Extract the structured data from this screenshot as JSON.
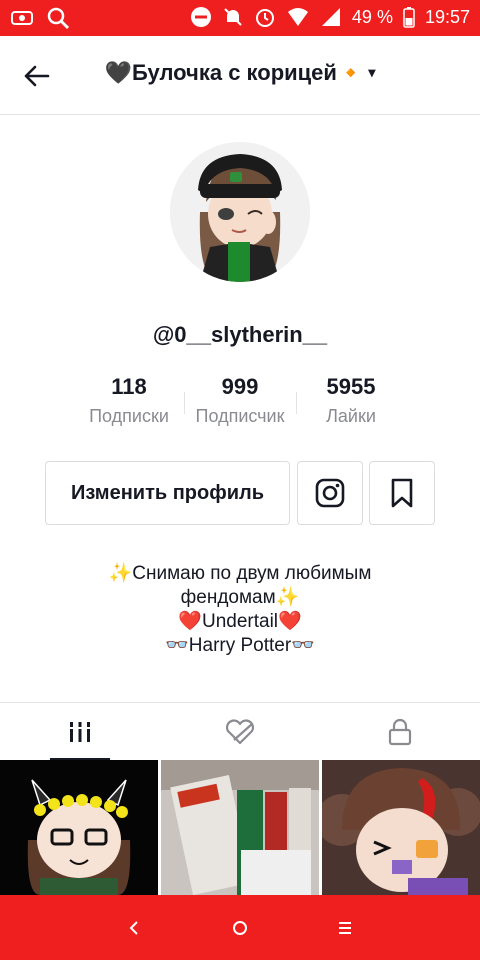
{
  "status_bar": {
    "battery_percent": "49 %",
    "time": "19:57"
  },
  "header": {
    "title": "🖤Булочка с корицей🔸",
    "caret": "▾"
  },
  "profile": {
    "username": "@0__slytherin__"
  },
  "stats": [
    {
      "value": "118",
      "label": "Подписки"
    },
    {
      "value": "999",
      "label": "Подписчик"
    },
    {
      "value": "5955",
      "label": "Лайки"
    }
  ],
  "actions": {
    "edit_label": "Изменить профиль"
  },
  "bio": {
    "lines": [
      "✨Снимаю по двум любимым",
      "фендомам✨",
      "❤️Undertail❤️",
      "👓Harry Potter👓"
    ]
  },
  "icons": {
    "back": "arrow-left-icon",
    "instagram": "instagram-icon",
    "bookmark": "bookmark-icon",
    "videos_tab": "grid-bars-icon",
    "liked_tab": "hidden-heart-icon",
    "private_tab": "lock-icon"
  },
  "colors": {
    "system_bar": "#ef1f1f",
    "text": "#161823",
    "secondary": "#8a8b91"
  }
}
